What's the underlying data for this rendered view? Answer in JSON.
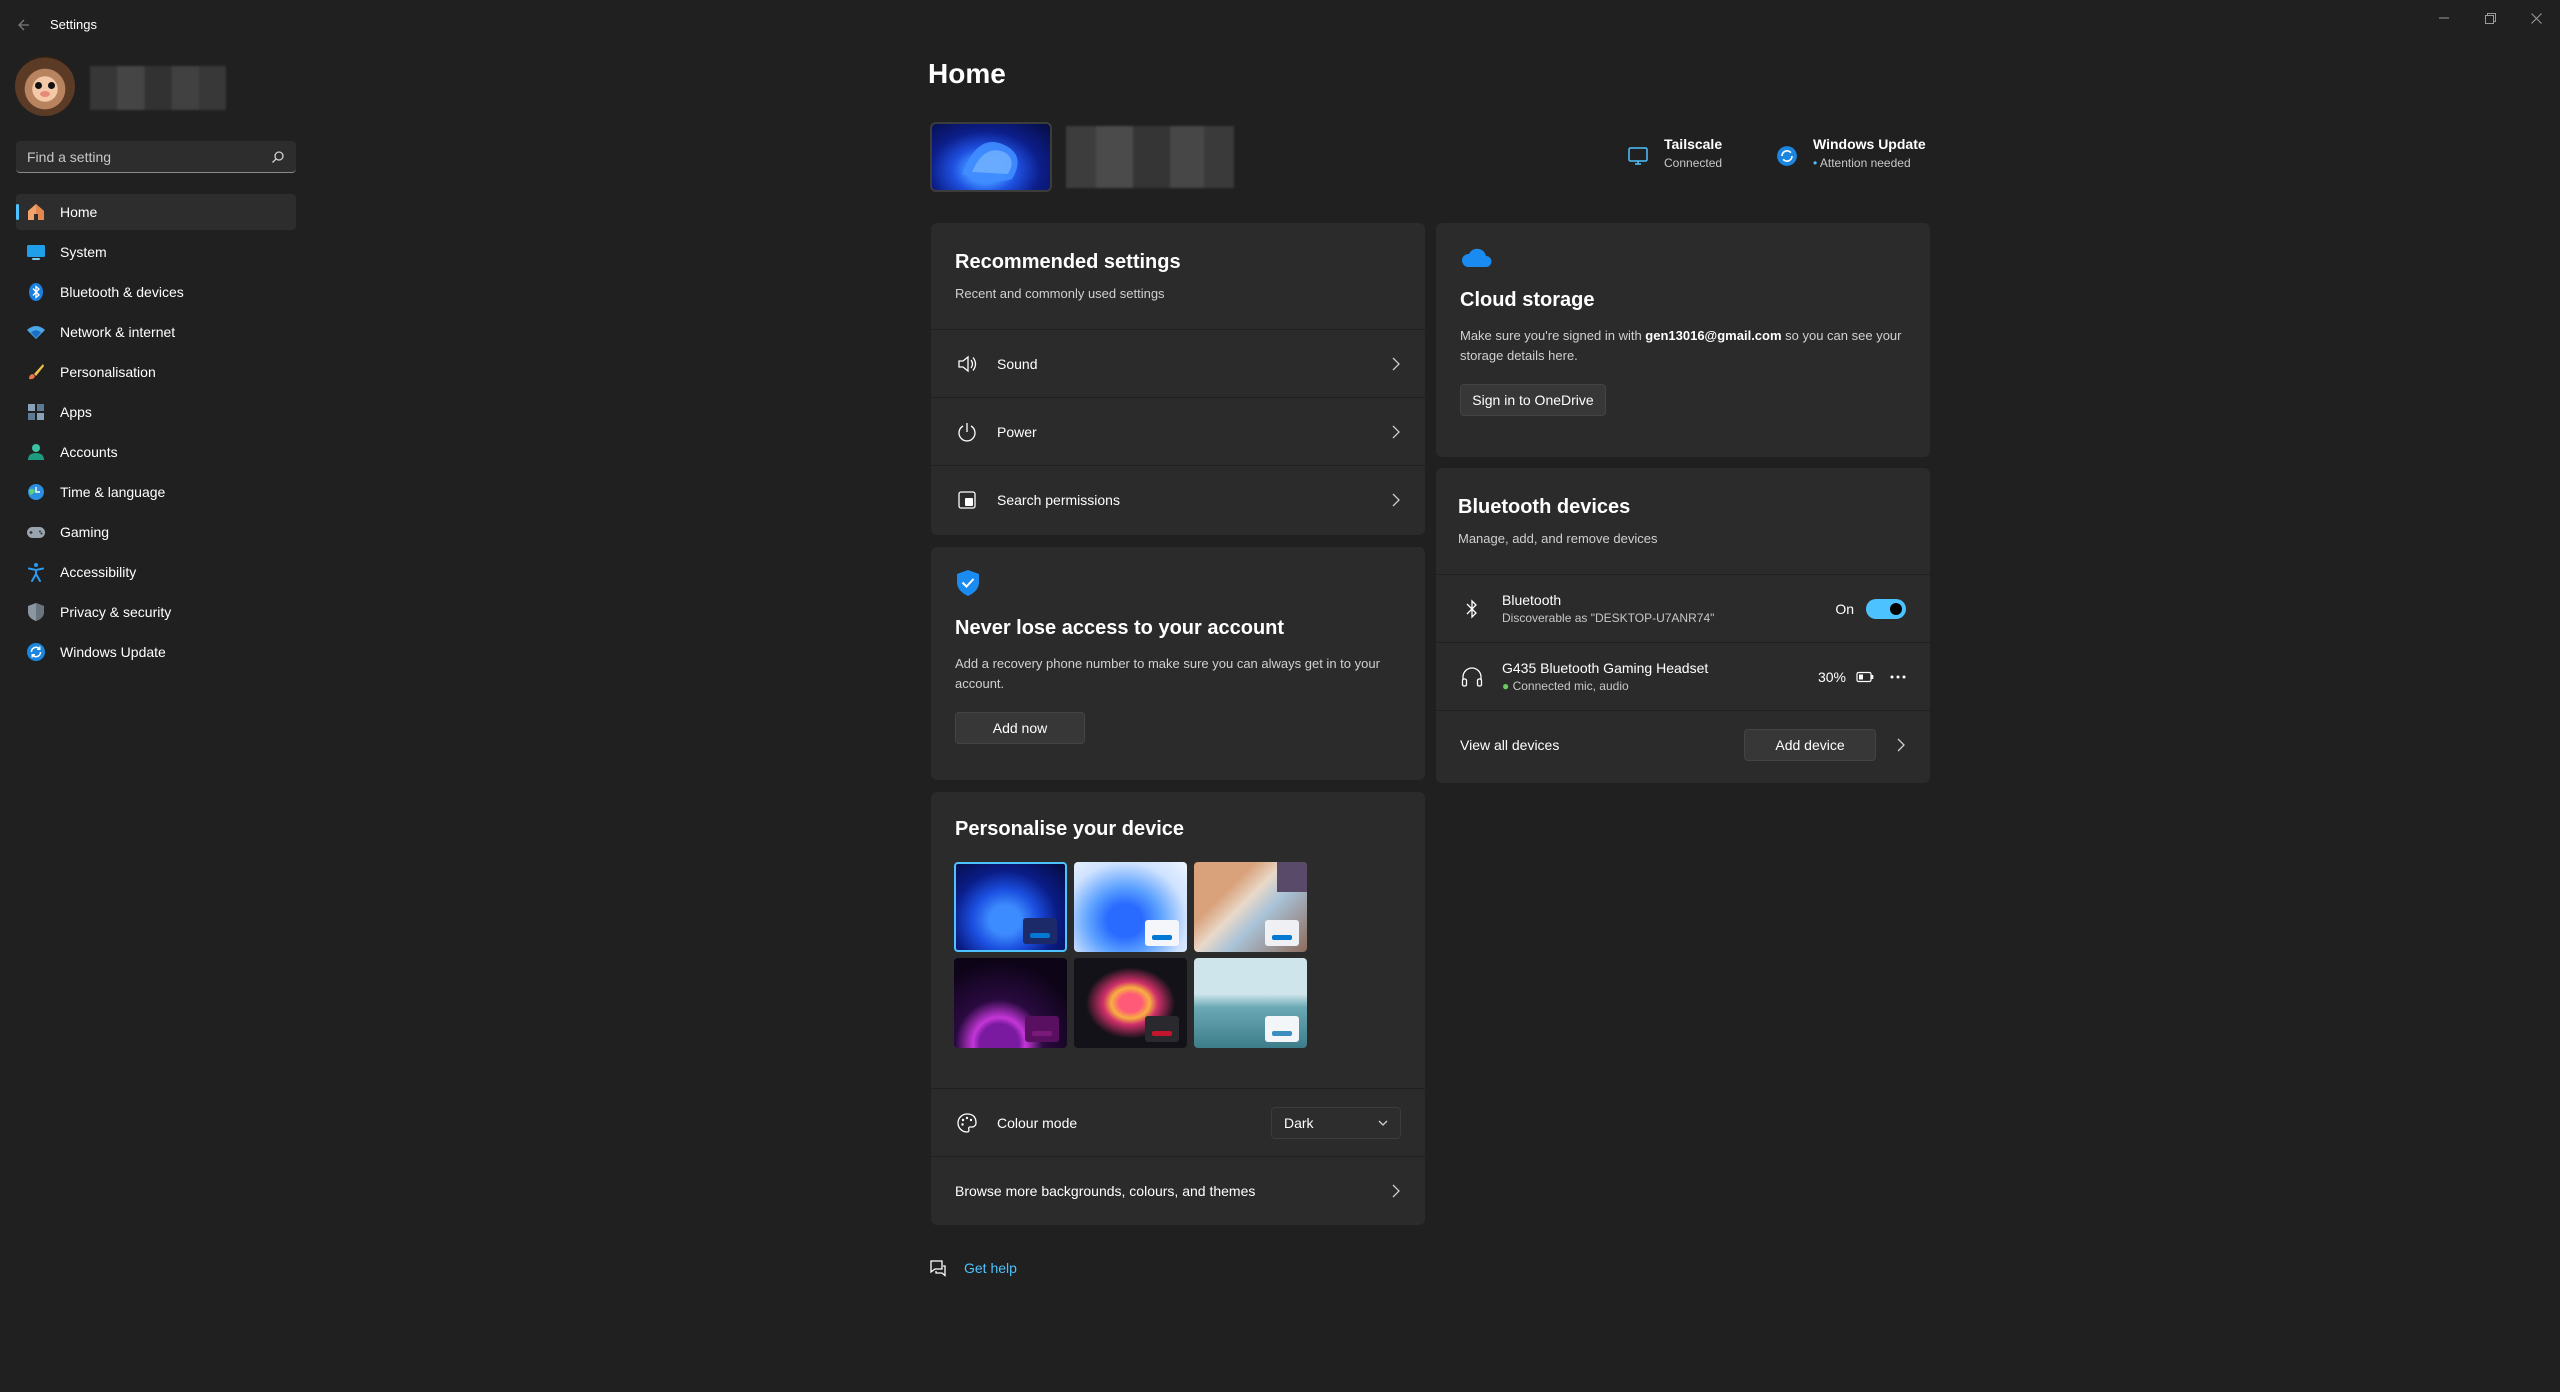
{
  "window": {
    "title": "Settings"
  },
  "sidebar": {
    "search_placeholder": "Find a setting",
    "items": [
      {
        "label": "Home",
        "icon": "home-icon",
        "active": true
      },
      {
        "label": "System",
        "icon": "system-icon"
      },
      {
        "label": "Bluetooth & devices",
        "icon": "bluetooth-icon"
      },
      {
        "label": "Network & internet",
        "icon": "network-icon"
      },
      {
        "label": "Personalisation",
        "icon": "personalisation-icon"
      },
      {
        "label": "Apps",
        "icon": "apps-icon"
      },
      {
        "label": "Accounts",
        "icon": "accounts-icon"
      },
      {
        "label": "Time & language",
        "icon": "time-language-icon"
      },
      {
        "label": "Gaming",
        "icon": "gaming-icon"
      },
      {
        "label": "Accessibility",
        "icon": "accessibility-icon"
      },
      {
        "label": "Privacy & security",
        "icon": "privacy-icon"
      },
      {
        "label": "Windows Update",
        "icon": "windows-update-icon"
      }
    ]
  },
  "main": {
    "title": "Home",
    "status": {
      "tailscale": {
        "title": "Tailscale",
        "subtitle": "Connected"
      },
      "windows_update": {
        "title": "Windows Update",
        "subtitle": "Attention needed"
      }
    },
    "recommended": {
      "title": "Recommended settings",
      "subtitle": "Recent and commonly used settings",
      "rows": [
        {
          "label": "Sound",
          "icon": "sound-icon"
        },
        {
          "label": "Power",
          "icon": "power-icon"
        },
        {
          "label": "Search permissions",
          "icon": "search-permissions-icon"
        }
      ]
    },
    "account": {
      "title": "Never lose access to your account",
      "body": "Add a recovery phone number to make sure you can always get in to your account.",
      "button": "Add now"
    },
    "personalise": {
      "title": "Personalise your device",
      "colour_mode_label": "Colour mode",
      "colour_mode_value": "Dark",
      "browse_label": "Browse more backgrounds, colours, and themes"
    },
    "cloud": {
      "title": "Cloud storage",
      "body_prefix": "Make sure you're signed in with ",
      "email": "gen13016@gmail.com",
      "body_suffix": " so you can see your storage details here.",
      "button": "Sign in to OneDrive"
    },
    "bluetooth": {
      "title": "Bluetooth devices",
      "subtitle": "Manage, add, and remove devices",
      "bt_label": "Bluetooth",
      "bt_sub": "Discoverable as \"DESKTOP-U7ANR74\"",
      "bt_state": "On",
      "bt_on": true,
      "device_name": "G435 Bluetooth Gaming Headset",
      "device_sub": "Connected mic, audio",
      "battery": "30%",
      "view_all": "View all devices",
      "add_device": "Add device"
    },
    "help": "Get help"
  },
  "colors": {
    "accent": "#4cc2ff",
    "background": "#202020",
    "card": "#2b2b2b"
  }
}
